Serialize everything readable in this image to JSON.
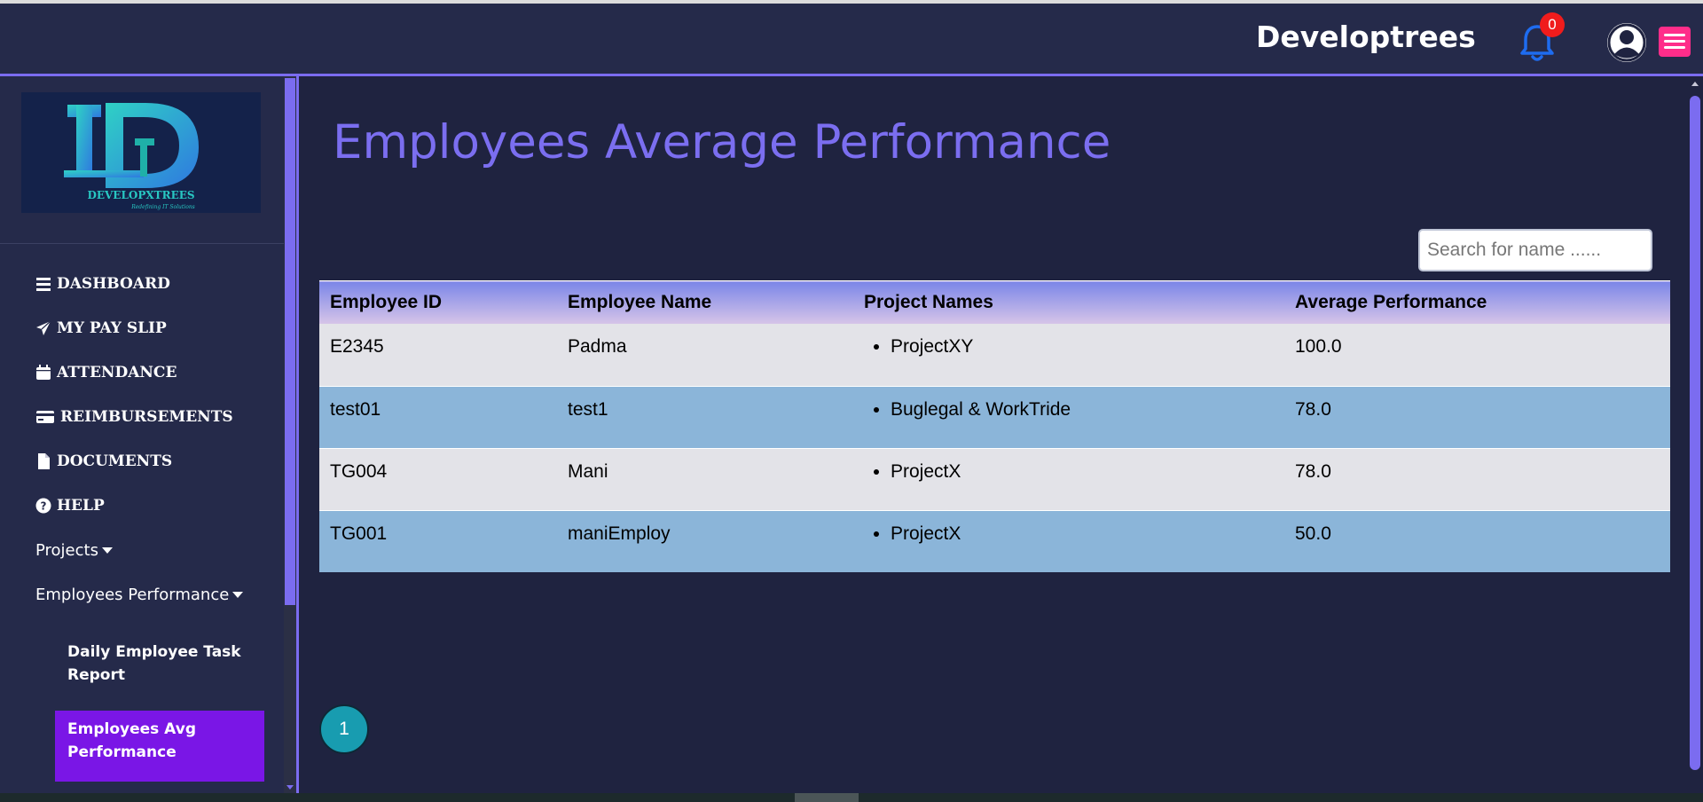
{
  "header": {
    "brand": "Developtrees",
    "notification_count": "0"
  },
  "sidebar": {
    "logo_text": "DEVELOPXTREES",
    "logo_tagline": "Redefining IT Solutions",
    "nav": [
      {
        "label": "DASHBOARD",
        "icon": "bars-icon"
      },
      {
        "label": "MY PAY SLIP",
        "icon": "paper-plane-icon"
      },
      {
        "label": "ATTENDANCE",
        "icon": "calendar-icon"
      },
      {
        "label": "REIMBURSEMENTS",
        "icon": "credit-card-icon"
      },
      {
        "label": "DOCUMENTS",
        "icon": "file-icon"
      },
      {
        "label": "HELP",
        "icon": "question-circle-icon"
      }
    ],
    "projects_label": "Projects",
    "employees_performance_label": "Employees Performance",
    "sub_items": [
      {
        "label": "Daily Employee Task Report"
      },
      {
        "label": "Employees Avg Performance"
      }
    ]
  },
  "main": {
    "title": "Employees Average Performance",
    "search_placeholder": "Search for name ......",
    "columns": [
      "Employee ID",
      "Employee Name",
      "Project Names",
      "Average Performance"
    ],
    "rows": [
      {
        "id": "E2345",
        "name": "Padma",
        "project": "ProjectXY",
        "avg": "100.0"
      },
      {
        "id": "test01",
        "name": "test1",
        "project": "Buglegal & WorkTride",
        "avg": "78.0"
      },
      {
        "id": "TG004",
        "name": "Mani",
        "project": "ProjectX",
        "avg": "78.0"
      },
      {
        "id": "TG001",
        "name": "maniEmploy",
        "project": "ProjectX",
        "avg": "50.0"
      }
    ],
    "pagination": {
      "current_page": "1"
    }
  },
  "colors": {
    "accent": "#7b6cf0",
    "title": "#7b6ef0",
    "active_item": "#7a16e6",
    "badge": "#f01c1c",
    "menu_button": "#ff2d8a",
    "row_light": "#e3e3e8",
    "row_blue": "#8bb5d9",
    "page_button": "#189cb0"
  }
}
